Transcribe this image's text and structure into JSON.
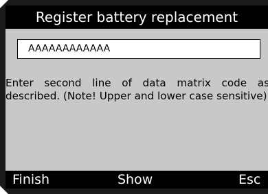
{
  "screen": {
    "title": "Register battery replacement",
    "input": {
      "value": "AAAAAAAAAAAA"
    },
    "instruction": "Enter second line of data matrix code as described. (Note! Upper and lower case sensitive)"
  },
  "softkeys": {
    "finish": "Finish",
    "show": "Show",
    "esc": "Esc"
  },
  "colors": {
    "screen_background": "#c8c8c8",
    "bars": "#000000",
    "bar_text": "#ffffff",
    "field_background": "#ffffff"
  }
}
